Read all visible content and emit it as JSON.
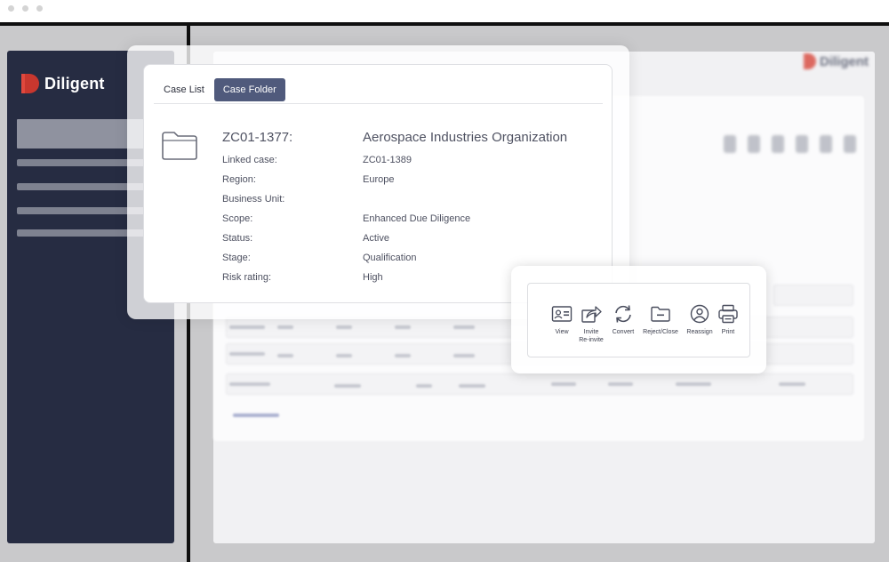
{
  "app": {
    "logo_text": "Diligent",
    "background_logo_text": "Diligent"
  },
  "tabs": [
    {
      "label": "Case List",
      "active": false
    },
    {
      "label": "Case Folder",
      "active": true
    }
  ],
  "case": {
    "id": "ZC01-1377:",
    "organization": "Aerospace Industries Organization",
    "fields": [
      {
        "label": "Linked case:",
        "value": "ZC01-1389"
      },
      {
        "label": "Region:",
        "value": "Europe"
      },
      {
        "label": "Business Unit:",
        "value": ""
      },
      {
        "label": "Scope:",
        "value": "Enhanced Due Diligence"
      },
      {
        "label": "Status:",
        "value": "Active"
      },
      {
        "label": "Stage:",
        "value": "Qualification"
      },
      {
        "label": "Risk rating:",
        "value": "High"
      }
    ]
  },
  "actions": [
    {
      "label": "View",
      "icon": "id-card-icon"
    },
    {
      "label": "Invite\nRe-invite",
      "icon": "share-icon"
    },
    {
      "label": "Convert",
      "icon": "refresh-icon"
    },
    {
      "label": "Reject/Close",
      "icon": "folder-icon"
    },
    {
      "label": "Reassign",
      "icon": "user-circle-icon"
    },
    {
      "label": "Print",
      "icon": "printer-icon"
    }
  ],
  "colors": {
    "sidebar": "#262c42",
    "active_tab": "#505a7c",
    "brand_red": "#e0483d",
    "text": "#4d5060"
  }
}
